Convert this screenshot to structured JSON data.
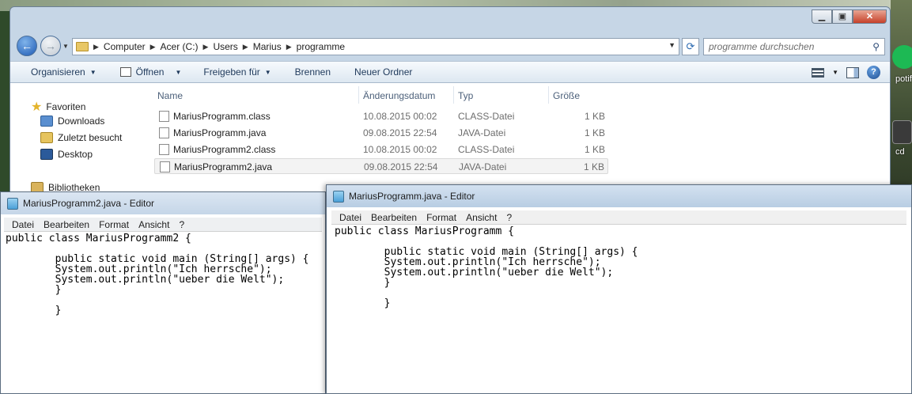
{
  "explorer": {
    "breadcrumb": [
      "Computer",
      "Acer (C:)",
      "Users",
      "Marius",
      "programme"
    ],
    "search_placeholder": "programme durchsuchen",
    "toolbar": {
      "organize": "Organisieren",
      "open": "Öffnen",
      "share": "Freigeben für",
      "burn": "Brennen",
      "new_folder": "Neuer Ordner"
    },
    "nav": {
      "favorites": "Favoriten",
      "downloads": "Downloads",
      "recent": "Zuletzt besucht",
      "desktop": "Desktop",
      "libraries": "Bibliotheken"
    },
    "columns": {
      "name": "Name",
      "date": "Änderungsdatum",
      "type": "Typ",
      "size": "Größe"
    },
    "files": [
      {
        "name": "MariusProgramm.class",
        "date": "10.08.2015 00:02",
        "type": "CLASS-Datei",
        "size": "1 KB"
      },
      {
        "name": "MariusProgramm.java",
        "date": "09.08.2015 22:54",
        "type": "JAVA-Datei",
        "size": "1 KB"
      },
      {
        "name": "MariusProgramm2.class",
        "date": "10.08.2015 00:02",
        "type": "CLASS-Datei",
        "size": "1 KB"
      },
      {
        "name": "MariusProgramm2.java",
        "date": "09.08.2015 22:54",
        "type": "JAVA-Datei",
        "size": "1 KB"
      }
    ]
  },
  "editor1": {
    "title": "MariusProgramm2.java - Editor",
    "menu": [
      "Datei",
      "Bearbeiten",
      "Format",
      "Ansicht",
      "?"
    ],
    "text": "public class MariusProgramm2 {\n\n        public static void main (String[] args) {\n        System.out.println(\"Ich herrsche\");\n        System.out.println(\"ueber die Welt\");\n        }\n\n        }"
  },
  "editor2": {
    "title": "MariusProgramm.java - Editor",
    "menu": [
      "Datei",
      "Bearbeiten",
      "Format",
      "Ansicht",
      "?"
    ],
    "text": "public class MariusProgramm {\n\n        public static void main (String[] args) {\n        System.out.println(\"Ich herrsche\");\n        System.out.println(\"ueber die Welt\");\n        }\n\n        }"
  },
  "desktop": {
    "spotify_label": "potif",
    "cd_label": "cd"
  }
}
